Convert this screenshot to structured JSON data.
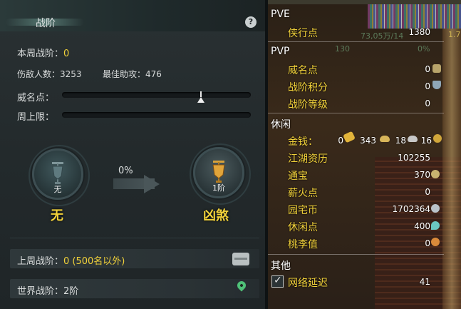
{
  "left_panel": {
    "title": "战阶",
    "help_label": "?",
    "weekly_rank_label": "本周战阶：",
    "weekly_rank_value": "0",
    "kills_label": "伤敌人数：",
    "kills_value": "3253",
    "assists_label": "最佳助攻：",
    "assists_value": "476",
    "prestige_label": "威名点：",
    "weekly_cap_label": "周上限：",
    "progress_percent": "0%",
    "current_rank": {
      "badge_label": "无",
      "name": "无"
    },
    "next_rank": {
      "badge_label": "1阶",
      "name": "凶煞"
    },
    "last_week_label": "上周战阶：",
    "last_week_value": "0 (500名以外)",
    "world_rank_label": "世界战阶：",
    "world_rank_value": "2阶"
  },
  "right_panel": {
    "pve": {
      "section": "PVE",
      "items": [
        {
          "label": "侠行点",
          "value": "1380"
        }
      ]
    },
    "pvp": {
      "section": "PVP",
      "items": [
        {
          "label": "威名点",
          "value": "0"
        },
        {
          "label": "战阶积分",
          "value": "0"
        },
        {
          "label": "战阶等级",
          "value": "0"
        }
      ]
    },
    "leisure": {
      "section": "休闲",
      "money_label": "金钱：",
      "money_gold": "0",
      "money_silver": "343",
      "money_copper": "18",
      "money_other": "16",
      "items": [
        {
          "label": "江湖资历",
          "value": "102255"
        },
        {
          "label": "通宝",
          "value": "370"
        },
        {
          "label": "薪火点",
          "value": "0"
        },
        {
          "label": "园宅币",
          "value": "1702364"
        },
        {
          "label": "休闲点",
          "value": "400"
        },
        {
          "label": "桃李值",
          "value": "0"
        }
      ]
    },
    "other": {
      "section": "其他",
      "network_label": "网络延迟",
      "network_value": "41",
      "network_checked": true
    },
    "background_overlay": {
      "line1": "73,05万/14",
      "line2": "130",
      "line3": "0%",
      "line4": "1.7"
    }
  }
}
